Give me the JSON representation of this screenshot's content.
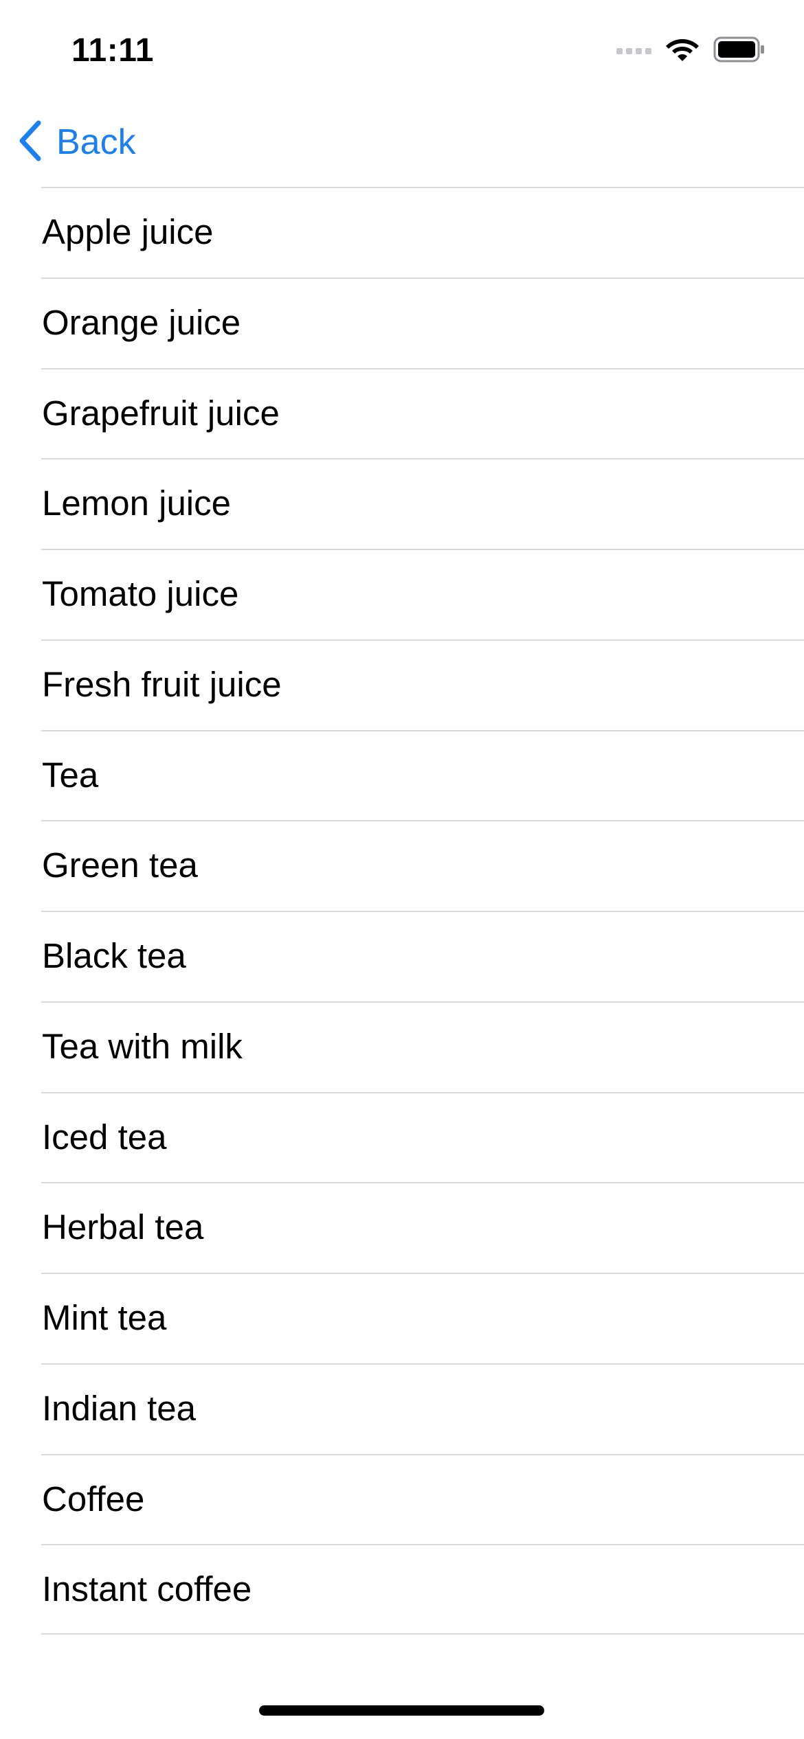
{
  "status_bar": {
    "time": "11:11"
  },
  "nav": {
    "back_label": "Back",
    "accent_color": "#1a7ff0"
  },
  "icons": {
    "status": [
      "signal-icon",
      "wifi-icon",
      "battery-icon"
    ],
    "nav": [
      "chevron-left-icon"
    ]
  },
  "list": {
    "items": [
      {
        "label": "Apple juice"
      },
      {
        "label": "Orange juice"
      },
      {
        "label": "Grapefruit juice"
      },
      {
        "label": "Lemon juice"
      },
      {
        "label": "Tomato juice"
      },
      {
        "label": "Fresh fruit juice"
      },
      {
        "label": "Tea"
      },
      {
        "label": "Green tea"
      },
      {
        "label": "Black tea"
      },
      {
        "label": "Tea with milk"
      },
      {
        "label": "Iced tea"
      },
      {
        "label": "Herbal tea"
      },
      {
        "label": "Mint tea"
      },
      {
        "label": "Indian tea"
      },
      {
        "label": "Coffee"
      },
      {
        "label": "Instant coffee"
      }
    ]
  }
}
